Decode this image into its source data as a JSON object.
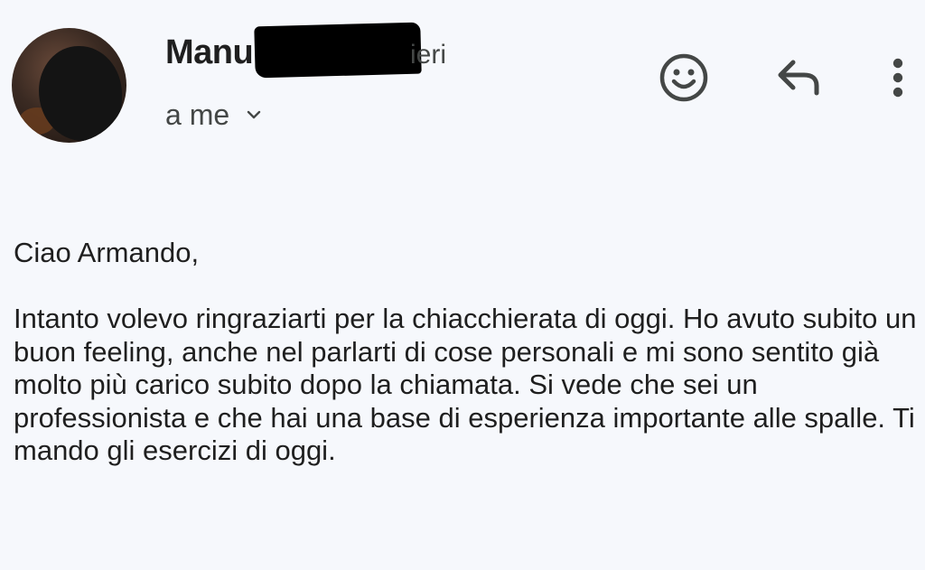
{
  "message": {
    "sender_name": "Manu",
    "date": "ieri",
    "recipient": "a me",
    "greeting": "Ciao Armando,",
    "paragraph": "Intanto volevo ringraziarti per la chiacchierata di oggi. Ho avuto subito un buon feeling, anche nel parlarti di cose personali e mi sono sentito già molto più carico subito dopo la chiamata. Si vede che sei un professionista e che hai una base di esperienza importante alle spalle. Ti mando gli esercizi di oggi."
  },
  "icons": {
    "avatar": "avatar-photo",
    "recipient_toggle": "chevron-down-icon",
    "emoji": "smiley-icon",
    "reply": "reply-icon",
    "more": "more-vert-icon"
  },
  "colors": {
    "background": "#f6f8fc",
    "text_primary": "#1f1f1f",
    "text_secondary": "#444746",
    "icon": "#444746",
    "redaction": "#000000"
  }
}
